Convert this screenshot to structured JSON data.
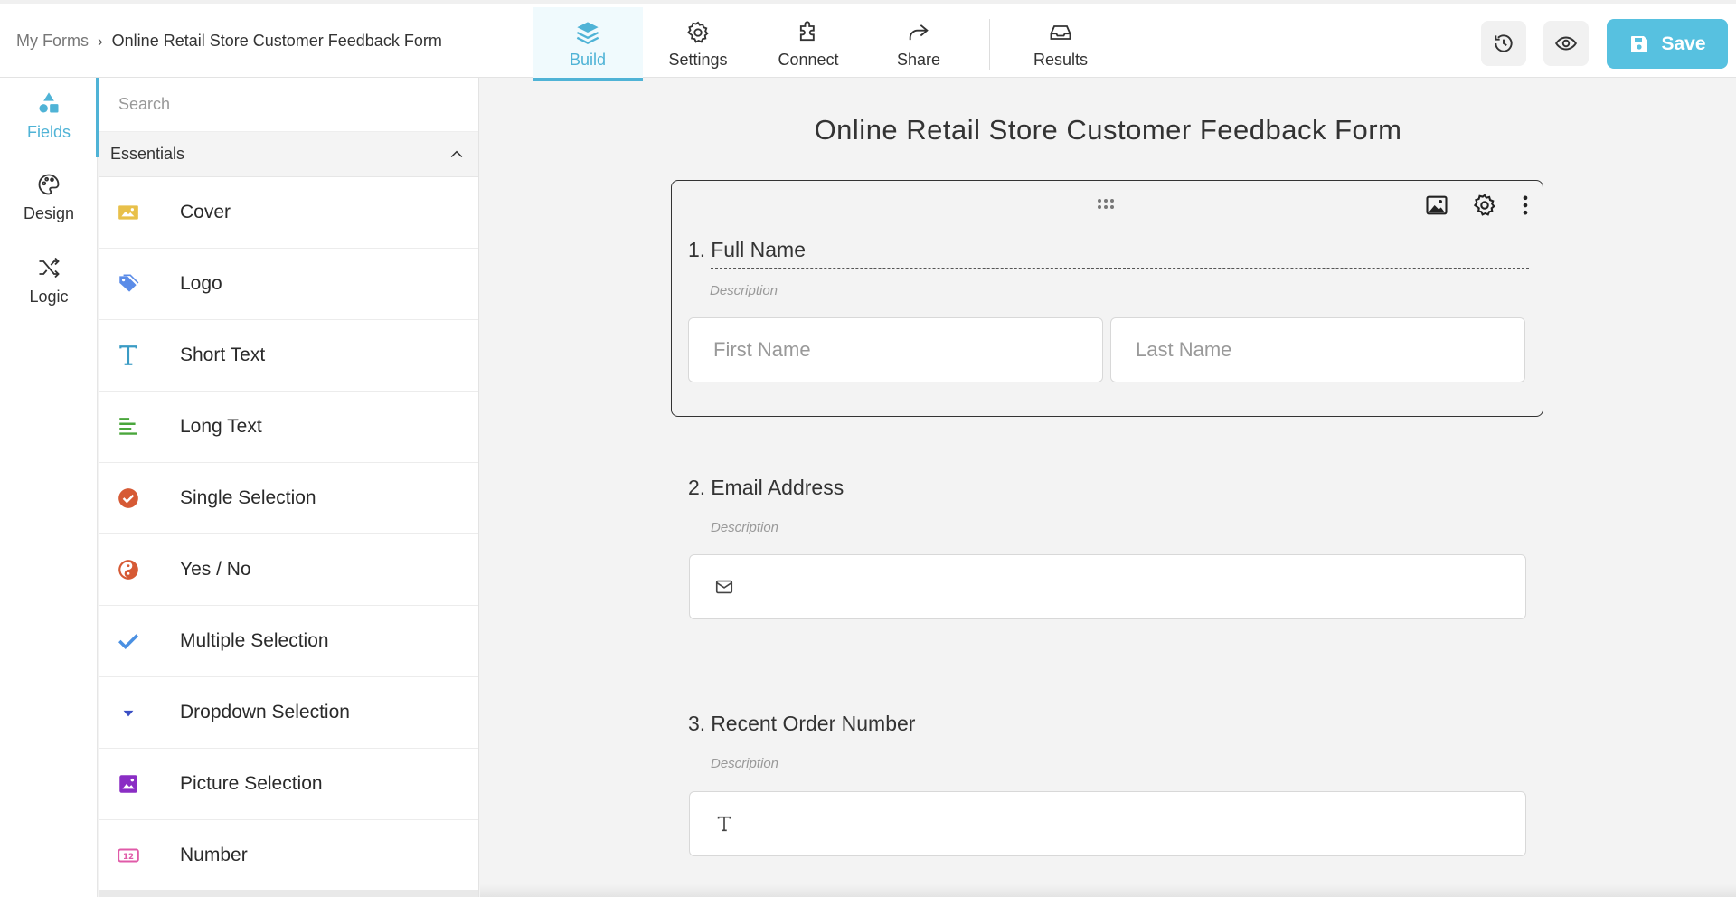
{
  "breadcrumb": {
    "root": "My Forms",
    "separator": "›",
    "current": "Online Retail Store Customer Feedback Form"
  },
  "nav": {
    "build": "Build",
    "settings": "Settings",
    "connect": "Connect",
    "share": "Share",
    "results": "Results"
  },
  "toolbar": {
    "save_label": "Save"
  },
  "rail": {
    "fields": "Fields",
    "design": "Design",
    "logic": "Logic"
  },
  "panel": {
    "search_placeholder": "Search",
    "section_title": "Essentials",
    "items": [
      {
        "label": "Cover",
        "icon": "cover-icon",
        "color": "#e8c04a"
      },
      {
        "label": "Logo",
        "icon": "tag-icon",
        "color": "#5b8ce8"
      },
      {
        "label": "Short Text",
        "icon": "text-icon",
        "color": "#3a9bc4"
      },
      {
        "label": "Long Text",
        "icon": "paragraph-icon",
        "color": "#4aa63c"
      },
      {
        "label": "Single Selection",
        "icon": "check-circle-icon",
        "color": "#d65a35"
      },
      {
        "label": "Yes / No",
        "icon": "yin-yang-icon",
        "color": "#d65a35"
      },
      {
        "label": "Multiple Selection",
        "icon": "checkmark-icon",
        "color": "#4a90e2"
      },
      {
        "label": "Dropdown Selection",
        "icon": "caret-down-icon",
        "color": "#3a4fc4"
      },
      {
        "label": "Picture Selection",
        "icon": "picture-icon",
        "color": "#8a2dc4"
      },
      {
        "label": "Number",
        "icon": "number-icon",
        "color": "#e05aa8"
      }
    ]
  },
  "form": {
    "title": "Online Retail Store Customer Feedback Form",
    "questions": [
      {
        "number": "1.",
        "title": "Full Name",
        "description": "Description",
        "first_placeholder": "First Name",
        "last_placeholder": "Last Name"
      },
      {
        "number": "2.",
        "title": "Email Address",
        "description": "Description"
      },
      {
        "number": "3.",
        "title": "Recent Order Number",
        "description": "Description"
      }
    ]
  },
  "colors": {
    "accent": "#4fb3d6",
    "save": "#57c1e0"
  }
}
